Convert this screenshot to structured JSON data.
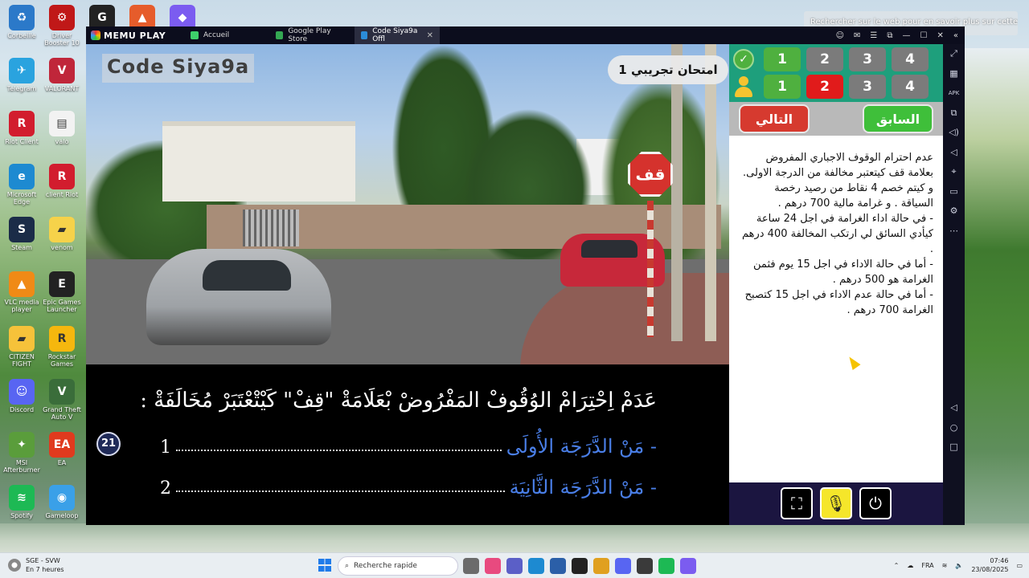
{
  "desktop": {
    "search_hint": "Rechercher sur le web pour en savoir plus sur cette image",
    "icons": [
      {
        "label": "Corbeille",
        "color": "#2b79c9",
        "glyph": "♻"
      },
      {
        "label": "Driver Booster 10",
        "color": "#c01818",
        "glyph": "⚙"
      },
      {
        "label": "",
        "color": "#222222",
        "glyph": "G"
      },
      {
        "label": "",
        "color": "#e65c2b",
        "glyph": "▲"
      },
      {
        "label": "",
        "color": "#7b5cf0",
        "glyph": "◆"
      },
      {
        "label": "Telegram",
        "color": "#2aa3df",
        "glyph": "✈"
      },
      {
        "label": "VALORANT",
        "color": "#c0263a",
        "glyph": "V"
      },
      {
        "label": "Riot Client",
        "color": "#d21d2e",
        "glyph": "R"
      },
      {
        "label": "valo",
        "color": "#f2f2f2",
        "glyph": "▤"
      },
      {
        "label": "Microsoft Edge",
        "color": "#1d8ad1",
        "glyph": "e"
      },
      {
        "label": "client Riot",
        "color": "#d21d2e",
        "glyph": "R"
      },
      {
        "label": "Steam",
        "color": "#1b2c48",
        "glyph": "S"
      },
      {
        "label": "venom",
        "color": "#f6d24a",
        "glyph": "▰"
      },
      {
        "label": "VLC media player",
        "color": "#f08a16",
        "glyph": "▲"
      },
      {
        "label": "Epic Games Launcher",
        "color": "#222222",
        "glyph": "E"
      },
      {
        "label": "CITIZEN FIGHT",
        "color": "#f6c23a",
        "glyph": "▰"
      },
      {
        "label": "Rockstar Games",
        "color": "#f5b70e",
        "glyph": "R"
      },
      {
        "label": "Discord",
        "color": "#5865f2",
        "glyph": "☺"
      },
      {
        "label": "Grand Theft Auto V",
        "color": "#3a6d3a",
        "glyph": "V"
      },
      {
        "label": "MSI Afterburner",
        "color": "#5a9d3b",
        "glyph": "✦"
      },
      {
        "label": "EA",
        "color": "#e03a1e",
        "glyph": "EA"
      },
      {
        "label": "Spotify",
        "color": "#1db954",
        "glyph": "≋"
      },
      {
        "label": "Gameloop",
        "color": "#3aa0e8",
        "glyph": "◉"
      }
    ]
  },
  "emulator": {
    "brand": "MEMU PLAY",
    "tabs": [
      {
        "label": "Accueil",
        "color": "#3ecf6b"
      },
      {
        "label": "Google Play Store",
        "color": "#34a853"
      },
      {
        "label": "Code Siya9a Offl",
        "color": "#2b8cd9"
      }
    ],
    "controls": [
      "☺",
      "✉",
      "☰",
      "⧉",
      "—",
      "☐",
      "✕",
      "«"
    ],
    "sidebar": [
      "⤢",
      "▦",
      "APK",
      "⧉",
      "◁)",
      "◁",
      "⌖",
      "▭",
      "⚙",
      "⋯",
      "",
      "",
      "",
      "",
      "",
      "",
      "",
      "",
      "◁",
      "○",
      "□"
    ]
  },
  "video": {
    "watermark": "Code Siya9a",
    "exam_label": "امتحان تجريبي 1",
    "sign_text": "قف"
  },
  "question": {
    "text": "عَدَمْ اِحْتِرَامْ الوُقُوفْ المَفْرُوضْ بْعَلَامَةْ \"قِفْ\" كَيْتْعْتَبَرْ مُخَالَفَةْ :",
    "options": [
      {
        "text": "- مَنْ الدَّرَجَة الأُولَى",
        "num": "1"
      },
      {
        "text": "- مَنْ الدَّرَجَة الثَّانِيَة",
        "num": "2"
      }
    ],
    "number": "21"
  },
  "answers": {
    "correct_row": [
      "1",
      "2",
      "3",
      "4"
    ],
    "correct_row_colors": [
      "green",
      "gray",
      "gray",
      "gray"
    ],
    "user_row": [
      "1",
      "2",
      "3",
      "4"
    ],
    "user_row_colors": [
      "green",
      "red",
      "gray",
      "gray"
    ],
    "check_glyph": "✓"
  },
  "nav": {
    "next_label": "التالي",
    "prev_label": "السابق"
  },
  "explanation": [
    "عدم احترام الوقوف الاجباري المفروض بعلامة قف كيتعتبر مخالفة من الدرجة الاولى. و كيتم خصم 4 نقاط من رصيد رخصة السياقة . و غرامة مالية 700 درهم .",
    "- في حالة اداء الغرامة في اجل 24 ساعة كيأدي السائق لي ارتكب المخالفة 400 درهم .",
    "- أما في حالة الاداء في اجل 15 يوم فثمن الغرامة هو 500 درهم .",
    "- أما في حالة عدم الاداء في اجل 15 كتصبح الغرامة 700 درهم ."
  ],
  "tools": {
    "screenshot_glyph": "⛶",
    "mic_glyph": "🎙",
    "power_glyph": "⏻"
  },
  "taskbar": {
    "weather_title": "SGE - SVW",
    "weather_sub": "En 7 heures",
    "search_placeholder": "Recherche rapide",
    "language": "FRA",
    "time": "07:46",
    "date": "23/08/2025",
    "apps": [
      {
        "color": "#6b6b6b"
      },
      {
        "color": "#e84a7f"
      },
      {
        "color": "#5b5fc7"
      },
      {
        "color": "#1d8ad1"
      },
      {
        "color": "#2b5fa8"
      },
      {
        "color": "#222222"
      },
      {
        "color": "#e0a020"
      },
      {
        "color": "#5865f2"
      },
      {
        "color": "#3a3a3a"
      },
      {
        "color": "#1db954"
      },
      {
        "color": "#7b5cf0"
      }
    ]
  }
}
